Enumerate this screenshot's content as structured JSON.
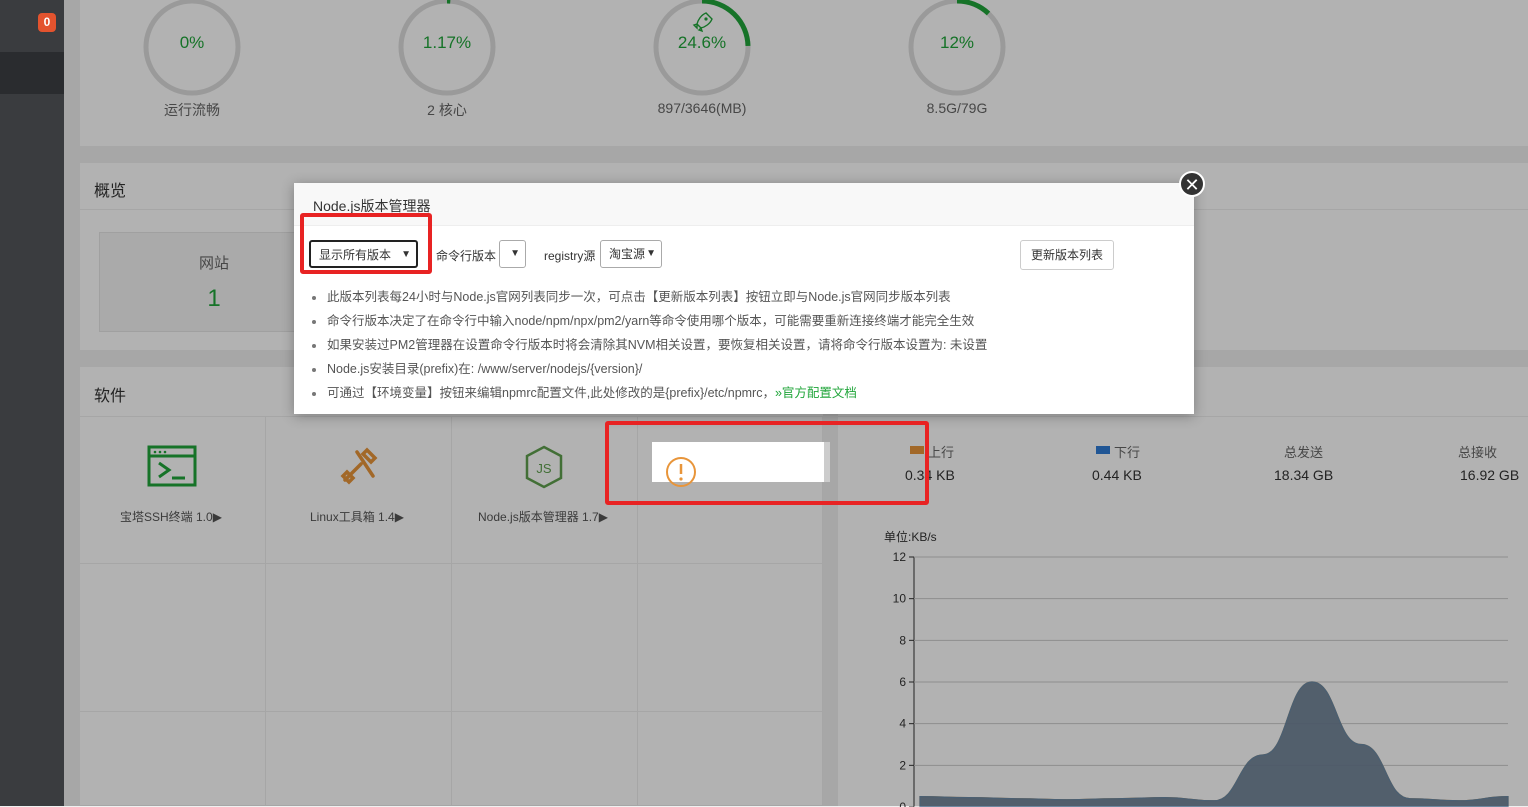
{
  "sidebar": {
    "badge": "0"
  },
  "gauges": [
    {
      "value": "0%",
      "label": "运行流畅",
      "fraction": 0
    },
    {
      "value": "1.17%",
      "label": "2 核心",
      "fraction": 0.0117
    },
    {
      "value": "24.6%",
      "label": "897/3646(MB)",
      "fraction": 0.246
    },
    {
      "value": "12%",
      "label": "8.5G/79G",
      "fraction": 0.12
    }
  ],
  "overview": {
    "title": "概览",
    "site_label": "网站",
    "site_count": "1"
  },
  "software": {
    "title": "软件",
    "items": [
      {
        "name": "宝塔SSH终端 1.0▶",
        "icon": "terminal-icon"
      },
      {
        "name": "Linux工具箱 1.4▶",
        "icon": "tools-icon"
      },
      {
        "name": "Node.js版本管理器 1.7▶",
        "icon": "nodejs-icon"
      }
    ]
  },
  "network": {
    "headers": [
      "上行",
      "下行",
      "总发送",
      "总接收"
    ],
    "values": [
      "0.34 KB",
      "0.44 KB",
      "18.34 GB",
      "16.92 GB"
    ],
    "colors": {
      "up": "#e8953a",
      "down": "#2f7bd6"
    }
  },
  "chart_data": {
    "type": "area",
    "title": "",
    "ylabel": "单位:KB/s",
    "ylim": [
      0,
      12
    ],
    "yticks": [
      "12",
      "10",
      "8",
      "6",
      "4",
      "2",
      "0"
    ],
    "series": [
      {
        "name": "上行",
        "values": [
          0.5,
          0.45,
          0.4,
          0.35,
          0.4,
          0.45,
          0.3,
          2.5,
          6.0,
          3.0,
          0.4,
          0.3,
          0.5
        ]
      },
      {
        "name": "下行",
        "values": [
          0.5,
          0.45,
          0.4,
          0.35,
          0.4,
          0.45,
          0.3,
          2.5,
          6.0,
          3.0,
          0.4,
          0.3,
          0.5
        ]
      }
    ]
  },
  "modal": {
    "title": "Node.js版本管理器",
    "version_filter": "显示所有版本",
    "cli_version_label": "命令行版本",
    "cli_version_value": "",
    "registry_label": "registry源",
    "registry_value": "淘宝源",
    "refresh_button": "更新版本列表",
    "tips": [
      "此版本列表每24小时与Node.js官网列表同步一次，可点击【更新版本列表】按钮立即与Node.js官网同步版本列表",
      "命令行版本决定了在命令行中输入node/npm/npx/pm2/yarn等命令使用哪个版本，可能需要重新连接终端才能完全生效",
      "如果安装过PM2管理器在设置命令行版本时将会清除其NVM相关设置，要恢复相关设置，请将命令行版本设置为: 未设置",
      "Node.js安装目录(prefix)在: /www/server/nodejs/{version}/",
      "可通过【环境变量】按钮来编辑npmrc配置文件,此处修改的是{prefix}/etc/npmrc，"
    ],
    "doc_link": "»官方配置文档"
  },
  "toast": {
    "icon": "warning-icon"
  }
}
